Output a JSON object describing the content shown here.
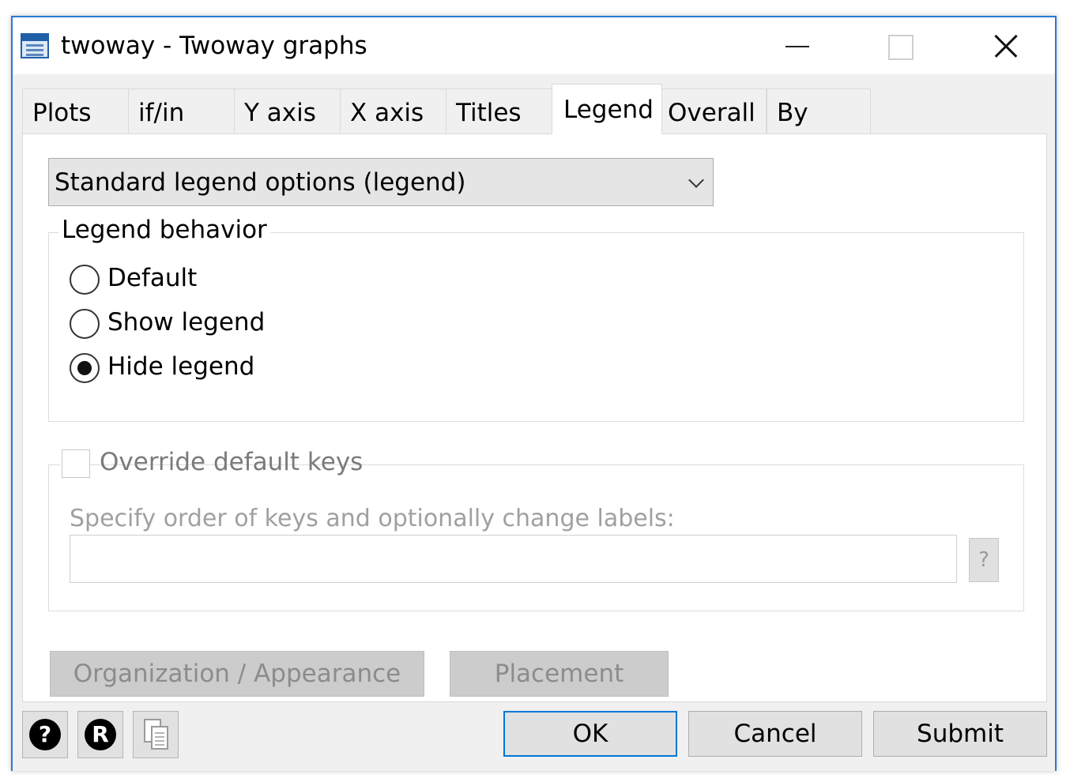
{
  "window": {
    "title": "twoway - Twoway graphs"
  },
  "tabs": [
    {
      "label": "Plots"
    },
    {
      "label": "if/in"
    },
    {
      "label": "Y axis"
    },
    {
      "label": "X axis"
    },
    {
      "label": "Titles"
    },
    {
      "label": "Legend",
      "active": true
    },
    {
      "label": "Overall"
    },
    {
      "label": "By"
    }
  ],
  "options_dropdown": {
    "selected": "Standard legend options (legend)"
  },
  "legend_behavior": {
    "title": "Legend behavior",
    "options": [
      {
        "label": "Default",
        "checked": false
      },
      {
        "label": "Show legend",
        "checked": false
      },
      {
        "label": "Hide legend",
        "checked": true
      }
    ]
  },
  "override_keys": {
    "label": "Override default keys",
    "checked": false,
    "enabled": false,
    "hint": "Specify order of keys and optionally change labels:",
    "value": "",
    "help_label": "?"
  },
  "buttons": {
    "organization": "Organization / Appearance",
    "placement": "Placement",
    "ok": "OK",
    "cancel": "Cancel",
    "submit": "Submit"
  },
  "icons": {
    "help": "?",
    "reset": "R"
  },
  "colors": {
    "accent": "#0078d7",
    "window_border": "#2b78d4"
  }
}
